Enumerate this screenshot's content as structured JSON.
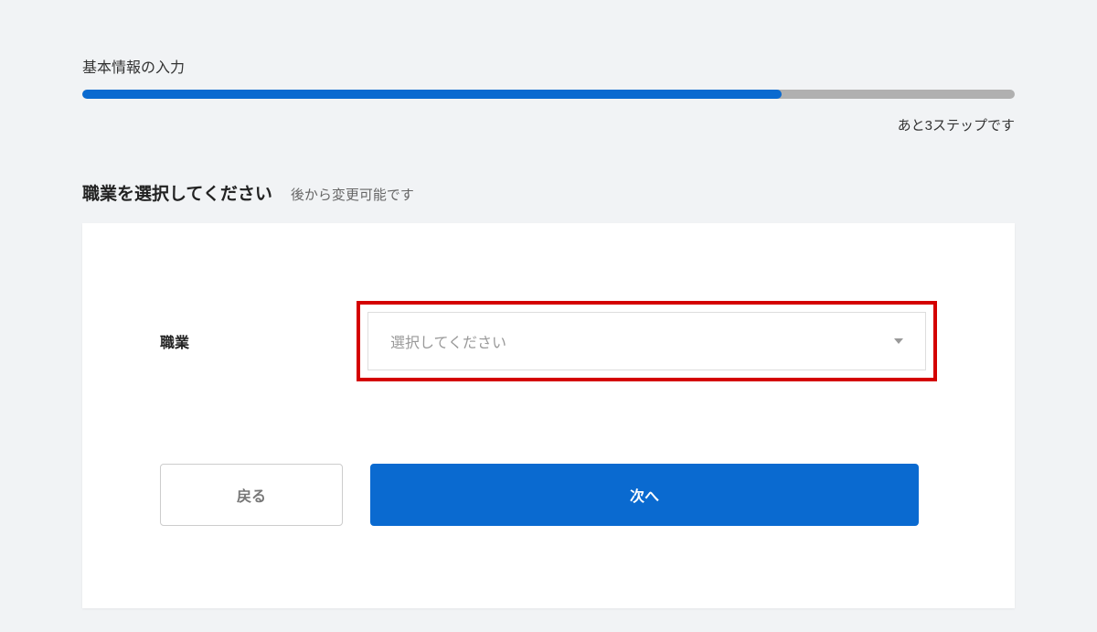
{
  "header": {
    "title": "基本情報の入力",
    "progress_percent": 75,
    "progress_text": "あと3ステップです"
  },
  "section": {
    "title": "職業を選択してください",
    "subtitle": "後から変更可能です"
  },
  "form": {
    "occupation": {
      "label": "職業",
      "placeholder": "選択してください"
    }
  },
  "buttons": {
    "back": "戻る",
    "next": "次へ"
  }
}
